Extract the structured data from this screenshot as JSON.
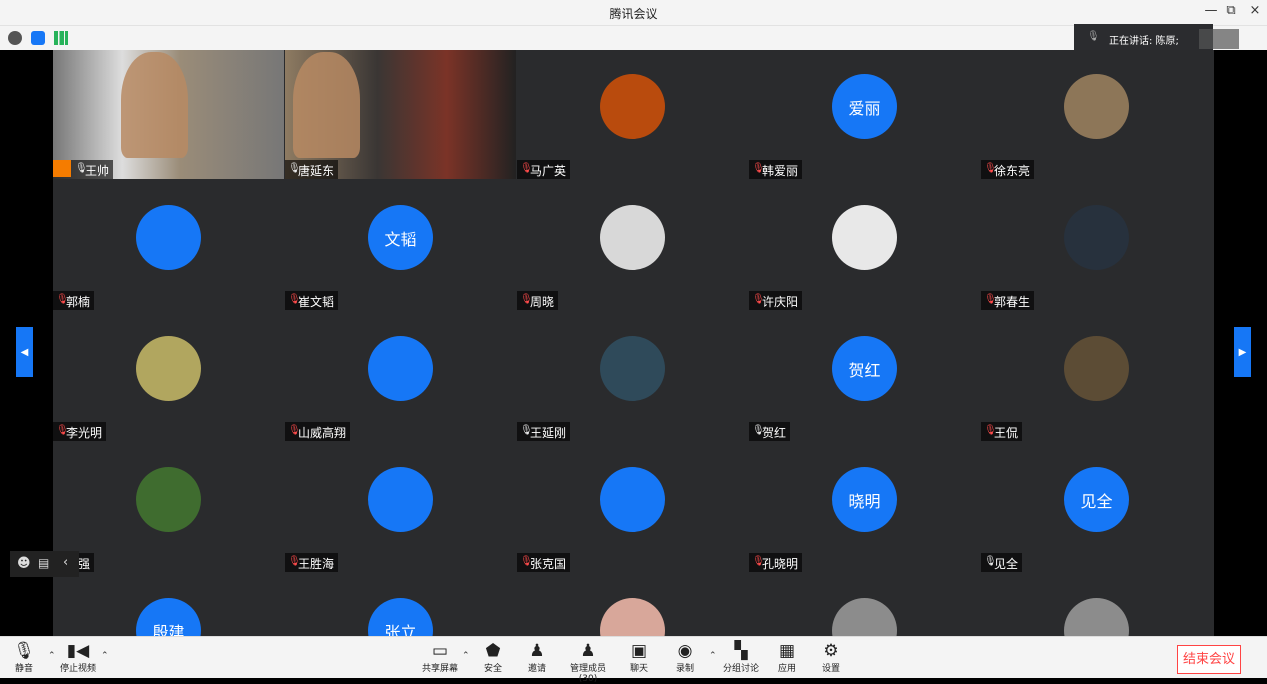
{
  "window": {
    "title": "腾讯会议"
  },
  "speaking": {
    "label": "正在讲话: 陈原;"
  },
  "participants": [
    {
      "name": "王帅",
      "avatar_text": "",
      "video": true,
      "muted": false,
      "host": true
    },
    {
      "name": "唐延东",
      "avatar_text": "",
      "video": true,
      "muted": false,
      "host": false
    },
    {
      "name": "马广英",
      "avatar_text": "",
      "video": false,
      "muted": true,
      "host": false
    },
    {
      "name": "韩爱丽",
      "avatar_text": "爱丽",
      "video": false,
      "muted": true,
      "host": false
    },
    {
      "name": "徐东亮",
      "avatar_text": "",
      "video": false,
      "muted": true,
      "host": false
    },
    {
      "name": "郭楠",
      "avatar_text": "",
      "video": false,
      "muted": true,
      "host": false
    },
    {
      "name": "崔文韬",
      "avatar_text": "文韬",
      "video": false,
      "muted": true,
      "host": false
    },
    {
      "name": "周晓",
      "avatar_text": "",
      "video": false,
      "muted": true,
      "host": false
    },
    {
      "name": "许庆阳",
      "avatar_text": "",
      "video": false,
      "muted": true,
      "host": false
    },
    {
      "name": "郭春生",
      "avatar_text": "",
      "video": false,
      "muted": true,
      "host": false
    },
    {
      "name": "李光明",
      "avatar_text": "",
      "video": false,
      "muted": true,
      "host": false
    },
    {
      "name": "山威高翔",
      "avatar_text": "",
      "video": false,
      "muted": true,
      "host": false
    },
    {
      "name": "王延刚",
      "avatar_text": "",
      "video": false,
      "muted": false,
      "host": false
    },
    {
      "name": "贺红",
      "avatar_text": "贺红",
      "video": false,
      "muted": false,
      "host": false
    },
    {
      "name": "王侃",
      "avatar_text": "",
      "video": false,
      "muted": true,
      "host": false
    },
    {
      "name": "翟强",
      "avatar_text": "",
      "video": false,
      "muted": true,
      "host": false
    },
    {
      "name": "王胜海",
      "avatar_text": "",
      "video": false,
      "muted": true,
      "host": false
    },
    {
      "name": "张克国",
      "avatar_text": "",
      "video": false,
      "muted": true,
      "host": false
    },
    {
      "name": "孔晓明",
      "avatar_text": "晓明",
      "video": false,
      "muted": true,
      "host": false
    },
    {
      "name": "见全",
      "avatar_text": "见全",
      "video": false,
      "muted": false,
      "host": false
    },
    {
      "name": "",
      "avatar_text": "殷建",
      "video": false,
      "muted": false,
      "host": false
    },
    {
      "name": "",
      "avatar_text": "张立",
      "video": false,
      "muted": false,
      "host": false
    },
    {
      "name": "",
      "avatar_text": "",
      "video": false,
      "muted": false,
      "host": false
    },
    {
      "name": "",
      "avatar_text": "",
      "video": false,
      "muted": false,
      "host": false
    },
    {
      "name": "",
      "avatar_text": "",
      "video": false,
      "muted": false,
      "host": false
    }
  ],
  "toolbar": {
    "mute": "静音",
    "video": "停止视频",
    "share": "共享屏幕",
    "security": "安全",
    "invite": "邀请",
    "members": "管理成员(30)",
    "chat": "聊天",
    "record": "录制",
    "breakout": "分组讨论",
    "apps": "应用",
    "settings": "设置",
    "end": "结束会议"
  },
  "colors": {
    "accent": "#1677f6",
    "danger": "#ff4444"
  }
}
